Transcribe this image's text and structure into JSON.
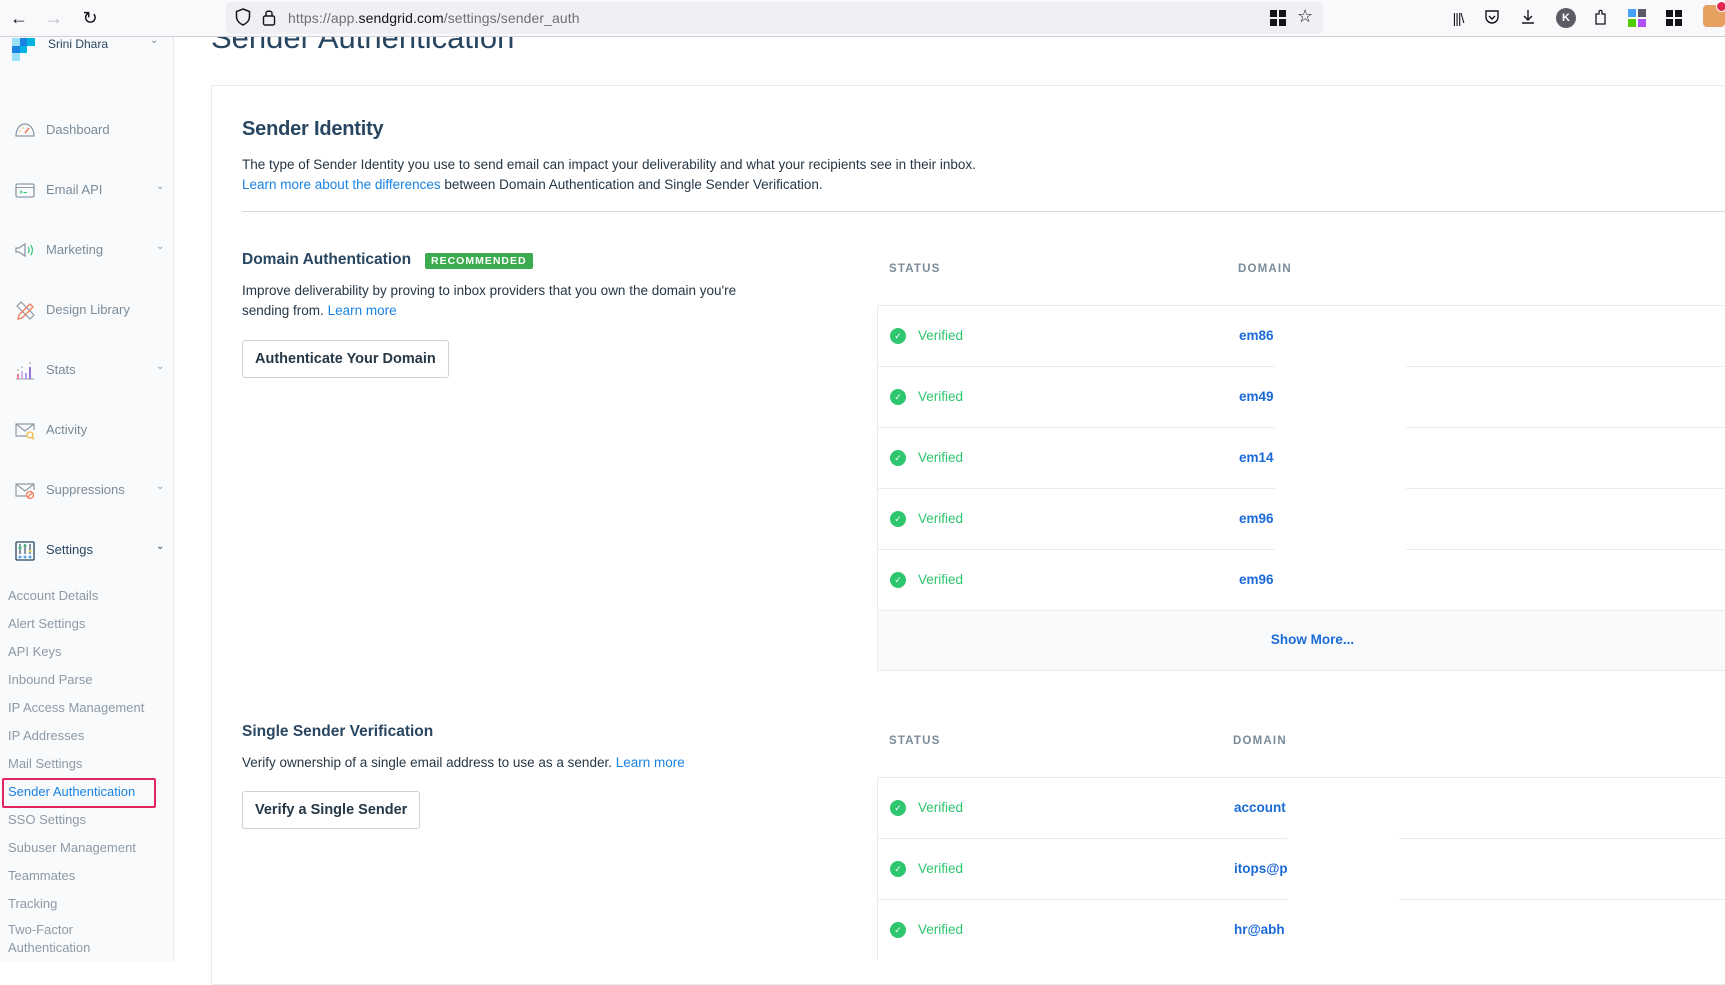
{
  "browser": {
    "url_host": "https://app.",
    "url_domain": "sendgrid.com",
    "url_path": "/settings/sender_auth",
    "profile_initial": "K"
  },
  "sidebar": {
    "account_name": "Srini Dhara",
    "nav": [
      {
        "label": "Dashboard",
        "icon": "dashboard-gauge-icon",
        "expandable": false
      },
      {
        "label": "Email API",
        "icon": "terminal-window-icon",
        "expandable": true
      },
      {
        "label": "Marketing",
        "icon": "megaphone-icon",
        "expandable": true
      },
      {
        "label": "Design Library",
        "icon": "pencil-ruler-icon",
        "expandable": false
      },
      {
        "label": "Stats",
        "icon": "bar-chart-icon",
        "expandable": true
      },
      {
        "label": "Activity",
        "icon": "envelope-search-icon",
        "expandable": false
      },
      {
        "label": "Suppressions",
        "icon": "envelope-blocked-icon",
        "expandable": true
      },
      {
        "label": "Settings",
        "icon": "sliders-icon",
        "expandable": true,
        "active": true
      }
    ],
    "settings_items": [
      "Account Details",
      "Alert Settings",
      "API Keys",
      "Inbound Parse",
      "IP Access Management",
      "IP Addresses",
      "Mail Settings",
      "Sender Authentication",
      "SSO Settings",
      "Subuser Management",
      "Teammates",
      "Tracking",
      "Two-Factor Authentication"
    ],
    "current_item": "Sender Authentication"
  },
  "page": {
    "title": "Sender Authentication",
    "sender_identity": {
      "title": "Sender Identity",
      "description": "The type of Sender Identity you use to send email can impact your deliverability and what your recipients see in their inbox.",
      "link_text": "Learn more about the differences",
      "link_suffix": " between Domain Authentication and Single Sender Verification."
    },
    "domain_auth": {
      "title": "Domain Authentication",
      "badge": "RECOMMENDED",
      "description": "Improve deliverability by proving to inbox providers that you own the domain you're sending from.",
      "learn_more": "Learn more",
      "button": "Authenticate Your Domain",
      "table": {
        "headers": {
          "status": "STATUS",
          "domain": "DOMAIN"
        },
        "rows": [
          {
            "status": "Verified",
            "domain": "em86"
          },
          {
            "status": "Verified",
            "domain": "em49"
          },
          {
            "status": "Verified",
            "domain": "em14"
          },
          {
            "status": "Verified",
            "domain": "em96"
          },
          {
            "status": "Verified",
            "domain": "em96"
          }
        ],
        "show_more": "Show More..."
      }
    },
    "single_sender": {
      "title": "Single Sender Verification",
      "description": "Verify ownership of a single email address to use as a sender.",
      "learn_more": "Learn more",
      "button": "Verify a Single Sender",
      "table": {
        "headers": {
          "status": "STATUS",
          "domain": "DOMAIN"
        },
        "rows": [
          {
            "status": "Verified",
            "domain": "account"
          },
          {
            "status": "Verified",
            "domain": "itops@p"
          },
          {
            "status": "Verified",
            "domain": "hr@abh"
          }
        ]
      }
    }
  },
  "colors": {
    "accent_link": "#1a82e2",
    "verified_green": "#2ec66e",
    "badge_green": "#3caa4e",
    "highlight_pink": "#e5245e"
  }
}
